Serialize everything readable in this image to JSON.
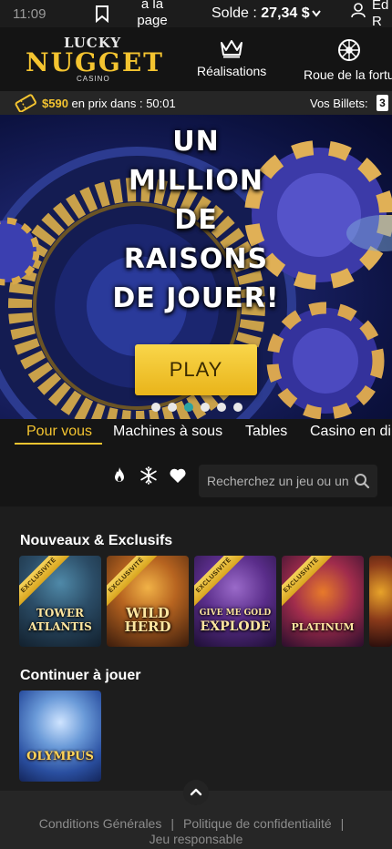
{
  "status_bar": {
    "time": "11:09",
    "home_label": "à la page d'accueil",
    "balance_label": "Solde : ",
    "balance_value": "27,34 $",
    "user_label": "Ed R"
  },
  "header": {
    "logo_lucky": "LUCKY",
    "logo_nugget": "NUGGET",
    "logo_casino": "CASINO",
    "nav": [
      {
        "label": "Réalisations",
        "icon": "crown-icon"
      },
      {
        "label": "Roue de la fortu",
        "icon": "wheel-icon"
      }
    ]
  },
  "prize_strip": {
    "amount": "$590",
    "text": " en prix dans : 50:01",
    "tickets_label": "Vos Billets:",
    "tickets_count": "3"
  },
  "banner": {
    "headline_lines": [
      "UN",
      "MILLION",
      "DE",
      "RAISONS",
      "DE JOUER!"
    ],
    "cta": "PLAY",
    "slides": 6,
    "active_slide": 3
  },
  "categories": {
    "items": [
      "Pour vous",
      "Machines à sous",
      "Tables",
      "Casino en di"
    ],
    "active": "Pour vous"
  },
  "search": {
    "placeholder": "Recherchez un jeu ou un fo"
  },
  "sections": {
    "new_title": "Nouveaux & Exclusifs",
    "new_ribbon": "EXCLUSIVITÉ",
    "new_games": [
      {
        "name_l1": "TOWER",
        "name_l2": "ATLANTIS"
      },
      {
        "name_l1": "WILD",
        "name_l2": "HERD"
      },
      {
        "name_l1": "GIVE ME GOLD",
        "name_l2": "EXPLODE"
      },
      {
        "name_l1": "",
        "name_l2": "PLATINUM"
      },
      {
        "name_l1": "",
        "name_l2": ""
      }
    ],
    "continue_title": "Continuer à jouer",
    "continue_game": "OLYMPUS"
  },
  "footer": {
    "terms": "Conditions Générales",
    "privacy": "Politique de confidentialité",
    "responsible": "Jeu responsable",
    "separator": "|"
  },
  "colors": {
    "accent": "#f4c430",
    "active_dot": "#2aa3a3",
    "background": "#151515"
  }
}
